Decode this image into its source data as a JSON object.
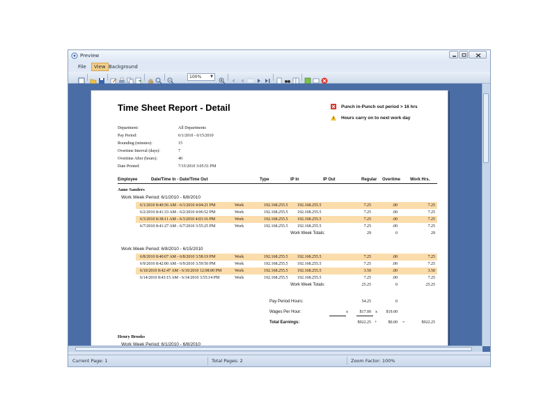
{
  "window": {
    "title": "Preview",
    "minimize_icon": "minimize-icon",
    "restore_icon": "restore-icon",
    "close_icon": "close-icon"
  },
  "menu": {
    "file": "File",
    "view": "View",
    "background": "Background"
  },
  "toolbar": {
    "zoom_value": "100%"
  },
  "report": {
    "title": "Time Sheet Report - Detail",
    "legend": [
      {
        "icon": "red-x-icon",
        "text": "Punch in-Punch out period > 16 hrs"
      },
      {
        "icon": "warning-icon",
        "text": "Hours carry on to next work day"
      }
    ],
    "info": [
      {
        "key": "Department:",
        "value": "All Departments"
      },
      {
        "key": "Pay Period:",
        "value": "6/1/2010 - 6/15/2010"
      },
      {
        "key": "Rounding (minutes):",
        "value": "15"
      },
      {
        "key": "Overtime Interval (days):",
        "value": "7"
      },
      {
        "key": "Overtime After (hours):",
        "value": "40"
      },
      {
        "key": "Date Printed:",
        "value": "7/15/2010 3:05:51 PM"
      }
    ],
    "columns": {
      "employee": "Employee",
      "datetime": "Date/Time In - Date/Time Out",
      "type": "Type",
      "ip_in": "IP In",
      "ip_out": "IP Out",
      "regular": "Regular",
      "overtime": "Overtime",
      "work_hrs": "Work Hrs."
    },
    "employees": [
      {
        "name": "Anne Sanders",
        "weeks": [
          {
            "label": "Work Week Period:  6/1/2010 - 6/8/2010",
            "rows": [
              {
                "dt": "6/1/2010 8:40:56 AM - 6/1/2010 4:04:21 PM",
                "type": "Work",
                "ip_in": "192.168.255.5",
                "ip_out": "192.168.255.5",
                "regular": "7.25",
                "overtime": ".00",
                "work": "7.25",
                "hl": true
              },
              {
                "dt": "6/2/2010 8:41:33 AM - 6/2/2010 4:06:52 PM",
                "type": "Work",
                "ip_in": "192.168.255.5",
                "ip_out": "192.168.255.5",
                "regular": "7.25",
                "overtime": ".00",
                "work": "7.25",
                "hl": false
              },
              {
                "dt": "6/3/2010 8:38:11 AM - 6/3/2010 4:03:16 PM",
                "type": "Work",
                "ip_in": "192.168.255.5",
                "ip_out": "192.168.255.5",
                "regular": "7.25",
                "overtime": ".00",
                "work": "7.25",
                "hl": true
              },
              {
                "dt": "6/7/2010 8:41:27 AM - 6/7/2010 3:55:25 PM",
                "type": "Work",
                "ip_in": "192.168.255.5",
                "ip_out": "192.168.255.5",
                "regular": "7.25",
                "overtime": ".00",
                "work": "7.25",
                "hl": false
              }
            ],
            "totals_label": "Work Week Totals:",
            "totals": {
              "regular": "29",
              "overtime": "0",
              "work": "29"
            }
          },
          {
            "label": "Work Week Period:  6/8/2010 - 6/15/2010",
            "rows": [
              {
                "dt": "6/8/2010 8:40:07 AM - 6/8/2010 3:58:19 PM",
                "type": "Work",
                "ip_in": "192.168.255.5",
                "ip_out": "192.168.255.5",
                "regular": "7.25",
                "overtime": ".00",
                "work": "7.25",
                "hl": true
              },
              {
                "dt": "6/9/2010 8:42:00 AM - 6/9/2010 3:59:50 PM",
                "type": "Work",
                "ip_in": "192.168.255.5",
                "ip_out": "192.168.255.5",
                "regular": "7.25",
                "overtime": ".00",
                "work": "7.25",
                "hl": false
              },
              {
                "dt": "6/10/2010 8:42:47 AM - 6/10/2010 12:08:00 PM",
                "type": "Work",
                "ip_in": "192.168.255.5",
                "ip_out": "192.168.255.5",
                "regular": "3.50",
                "overtime": ".00",
                "work": "3.50",
                "hl": true
              },
              {
                "dt": "6/14/2010 8:43:15 AM - 6/14/2010 3:55:14 PM",
                "type": "Work",
                "ip_in": "192.168.255.5",
                "ip_out": "192.168.255.5",
                "regular": "7.25",
                "overtime": ".00",
                "work": "7.25",
                "hl": false
              }
            ],
            "totals_label": "Work Week Totals:",
            "totals": {
              "regular": "25.25",
              "overtime": "0",
              "work": "25.25"
            }
          }
        ],
        "summary": {
          "pay_period_label": "Pay Period Hours:",
          "pay_regular": "54.25",
          "pay_overtime": "0",
          "wages_label": "Wages Per Hour:",
          "x1": "x",
          "wage_regular": "$17.00",
          "x2": "x",
          "wage_overtime": "$19.00",
          "earnings_label": "Total Earnings:",
          "earn_regular": "$922.25",
          "plus": "+",
          "earn_overtime": "$0.00",
          "eq": "=",
          "earn_total": "$922.25"
        }
      },
      {
        "name": "Henry Brooks",
        "weeks": [
          {
            "label": "Work Week Period:  6/1/2010 - 6/8/2010"
          }
        ]
      }
    ]
  },
  "status": {
    "current_page": "Current Page: 1",
    "total_pages": "Total Pages: 2",
    "zoom_factor": "Zoom Factor: 100%"
  },
  "colors": {
    "highlight_row": "#fbdcab",
    "viewport_bg": "#4a6da6"
  }
}
